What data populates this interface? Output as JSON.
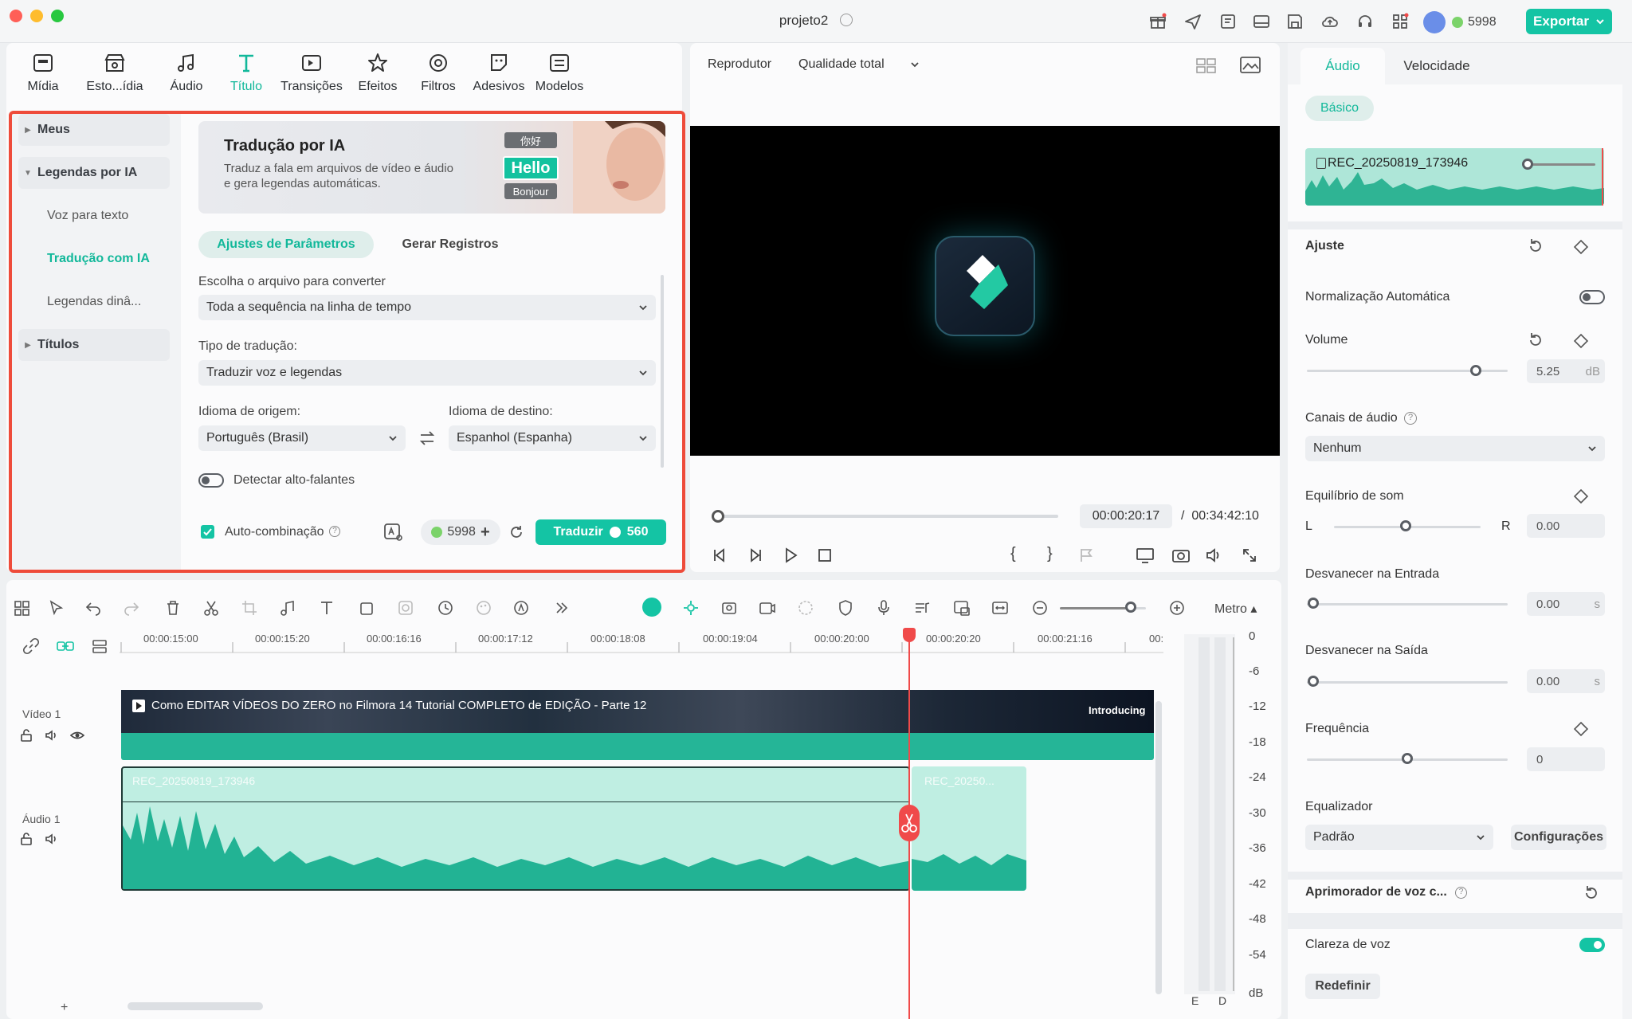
{
  "window": {
    "title": "projeto2",
    "credits": "5998",
    "export_label": "Exportar"
  },
  "library_tabs": [
    {
      "label": "Mídia",
      "icon": "media-icon"
    },
    {
      "label": "Esto...ídia",
      "icon": "store-icon"
    },
    {
      "label": "Áudio",
      "icon": "music-note-icon"
    },
    {
      "label": "Título",
      "icon": "title-t-icon"
    },
    {
      "label": "Transições",
      "icon": "transition-icon"
    },
    {
      "label": "Efeitos",
      "icon": "effects-icon"
    },
    {
      "label": "Filtros",
      "icon": "filters-icon"
    },
    {
      "label": "Adesivos",
      "icon": "stickers-icon"
    },
    {
      "label": "Modelos",
      "icon": "templates-icon"
    }
  ],
  "sidebar": {
    "items": [
      {
        "label": "Meus"
      },
      {
        "label": "Legendas por IA"
      },
      {
        "label": "Voz para texto"
      },
      {
        "label": "Tradução com IA"
      },
      {
        "label": "Legendas dinâ..."
      },
      {
        "label": "Títulos"
      }
    ]
  },
  "banner": {
    "title": "Tradução por IA",
    "description": "Traduz a fala em arquivos de vídeo e áudio e gera legendas automáticas.",
    "chips": [
      "你好",
      "Hello",
      "Bonjour"
    ]
  },
  "tabs": {
    "params": "Ajustes de Parâmetros",
    "logs": "Gerar Registros"
  },
  "form": {
    "file_label": "Escolha o arquivo para converter",
    "file_value": "Toda a sequência na linha de tempo",
    "type_label": "Tipo de tradução:",
    "type_value": "Traduzir voz e legendas",
    "source_label": "Idioma de origem:",
    "source_value": "Português (Brasil)",
    "target_label": "Idioma de destino:",
    "target_value": "Espanhol (Espanha)",
    "detect_label": "Detectar alto-falantes",
    "auto_label": "Auto-combinação",
    "credits": "5998",
    "translate_label": "Traduzir",
    "translate_cost": "560"
  },
  "player": {
    "label": "Reprodutor",
    "quality": "Qualidade total",
    "current_time": "00:00:20:17",
    "separator": "/",
    "total_time": "00:34:42:10"
  },
  "properties": {
    "tabs": {
      "audio": "Áudio",
      "speed": "Velocidade"
    },
    "basic_chip": "Básico",
    "clip_name": "REC_20250819_173946",
    "adjust": "Ajuste",
    "normalize": "Normalização Automática",
    "volume": "Volume",
    "volume_value": "5.25",
    "volume_unit": "dB",
    "channels": "Canais de áudio",
    "channels_value": "Nenhum",
    "balance": "Equilíbrio de som",
    "balance_left": "L",
    "balance_right": "R",
    "balance_value": "0.00",
    "fade_in": "Desvanecer na Entrada",
    "fade_in_value": "0.00",
    "fade_out": "Desvanecer na Saída",
    "fade_out_value": "0.00",
    "seconds_unit": "s",
    "pitch": "Frequência",
    "pitch_value": "0",
    "equalizer": "Equalizador",
    "equalizer_value": "Padrão",
    "equalizer_settings": "Configurações",
    "voice_enhancer": "Aprimorador de voz c...",
    "voice_clarity": "Clareza de voz",
    "reset": "Redefinir"
  },
  "timeline": {
    "ruler": [
      "00:00:15:00",
      "00:00:15:20",
      "00:00:16:16",
      "00:00:17:12",
      "00:00:18:08",
      "00:00:19:04",
      "00:00:20:00",
      "00:00:20:20",
      "00:00:21:16",
      "00:"
    ],
    "meter_label": "Metro",
    "video_track": "Vídeo 1",
    "audio_track": "Áudio 1",
    "video_clip_title": "Como EDITAR VÍDEOS DO ZERO no Filmora 14  Tutorial COMPLETO de EDIÇÃO - Parte 12",
    "video_end_label": "Introducing",
    "audio_clip_a": "REC_20250819_173946",
    "audio_clip_b": "REC_20250...",
    "meter_scale": [
      "0",
      "-6",
      "-12",
      "-18",
      "-24",
      "-30",
      "-36",
      "-42",
      "-48",
      "-54",
      "dB"
    ],
    "meter_channels": [
      "E",
      "D"
    ],
    "add": "+"
  },
  "colors": {
    "accent": "#14c4a4",
    "playhead": "#f04a4a",
    "highlight_frame": "#ee4b3a"
  }
}
